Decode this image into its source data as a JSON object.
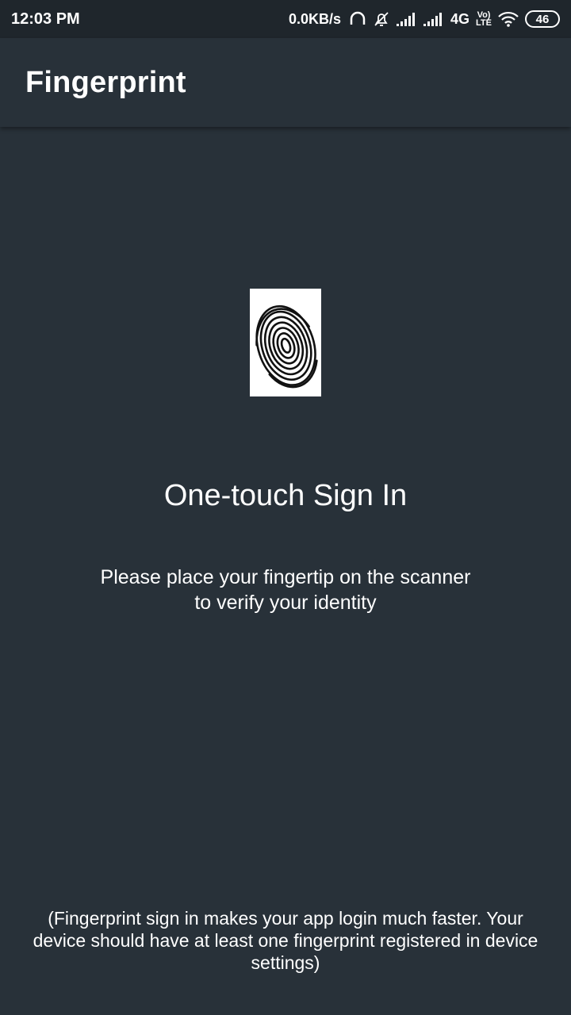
{
  "status_bar": {
    "time": "12:03 PM",
    "net_speed": "0.0KB/s",
    "network_type": "4G",
    "volte_top": "Vo)",
    "volte_bottom": "LTE",
    "battery": "46",
    "icons": [
      "headphones-icon",
      "bell-off-icon",
      "signal-icon",
      "signal-icon",
      "wifi-icon",
      "battery-icon"
    ]
  },
  "app_bar": {
    "title": "Fingerprint"
  },
  "main": {
    "fingerprint_icon": "fingerprint-icon",
    "headline": "One-touch Sign In",
    "instruction_line1": "Please place your fingertip on the scanner",
    "instruction_line2": "to verify your identity",
    "footnote": "(Fingerprint sign in makes your app login much faster. Your device should have at least one fingerprint registered in device settings)"
  },
  "colors": {
    "background": "#283139",
    "status_bar": "#1f262c",
    "text": "#ffffff"
  }
}
